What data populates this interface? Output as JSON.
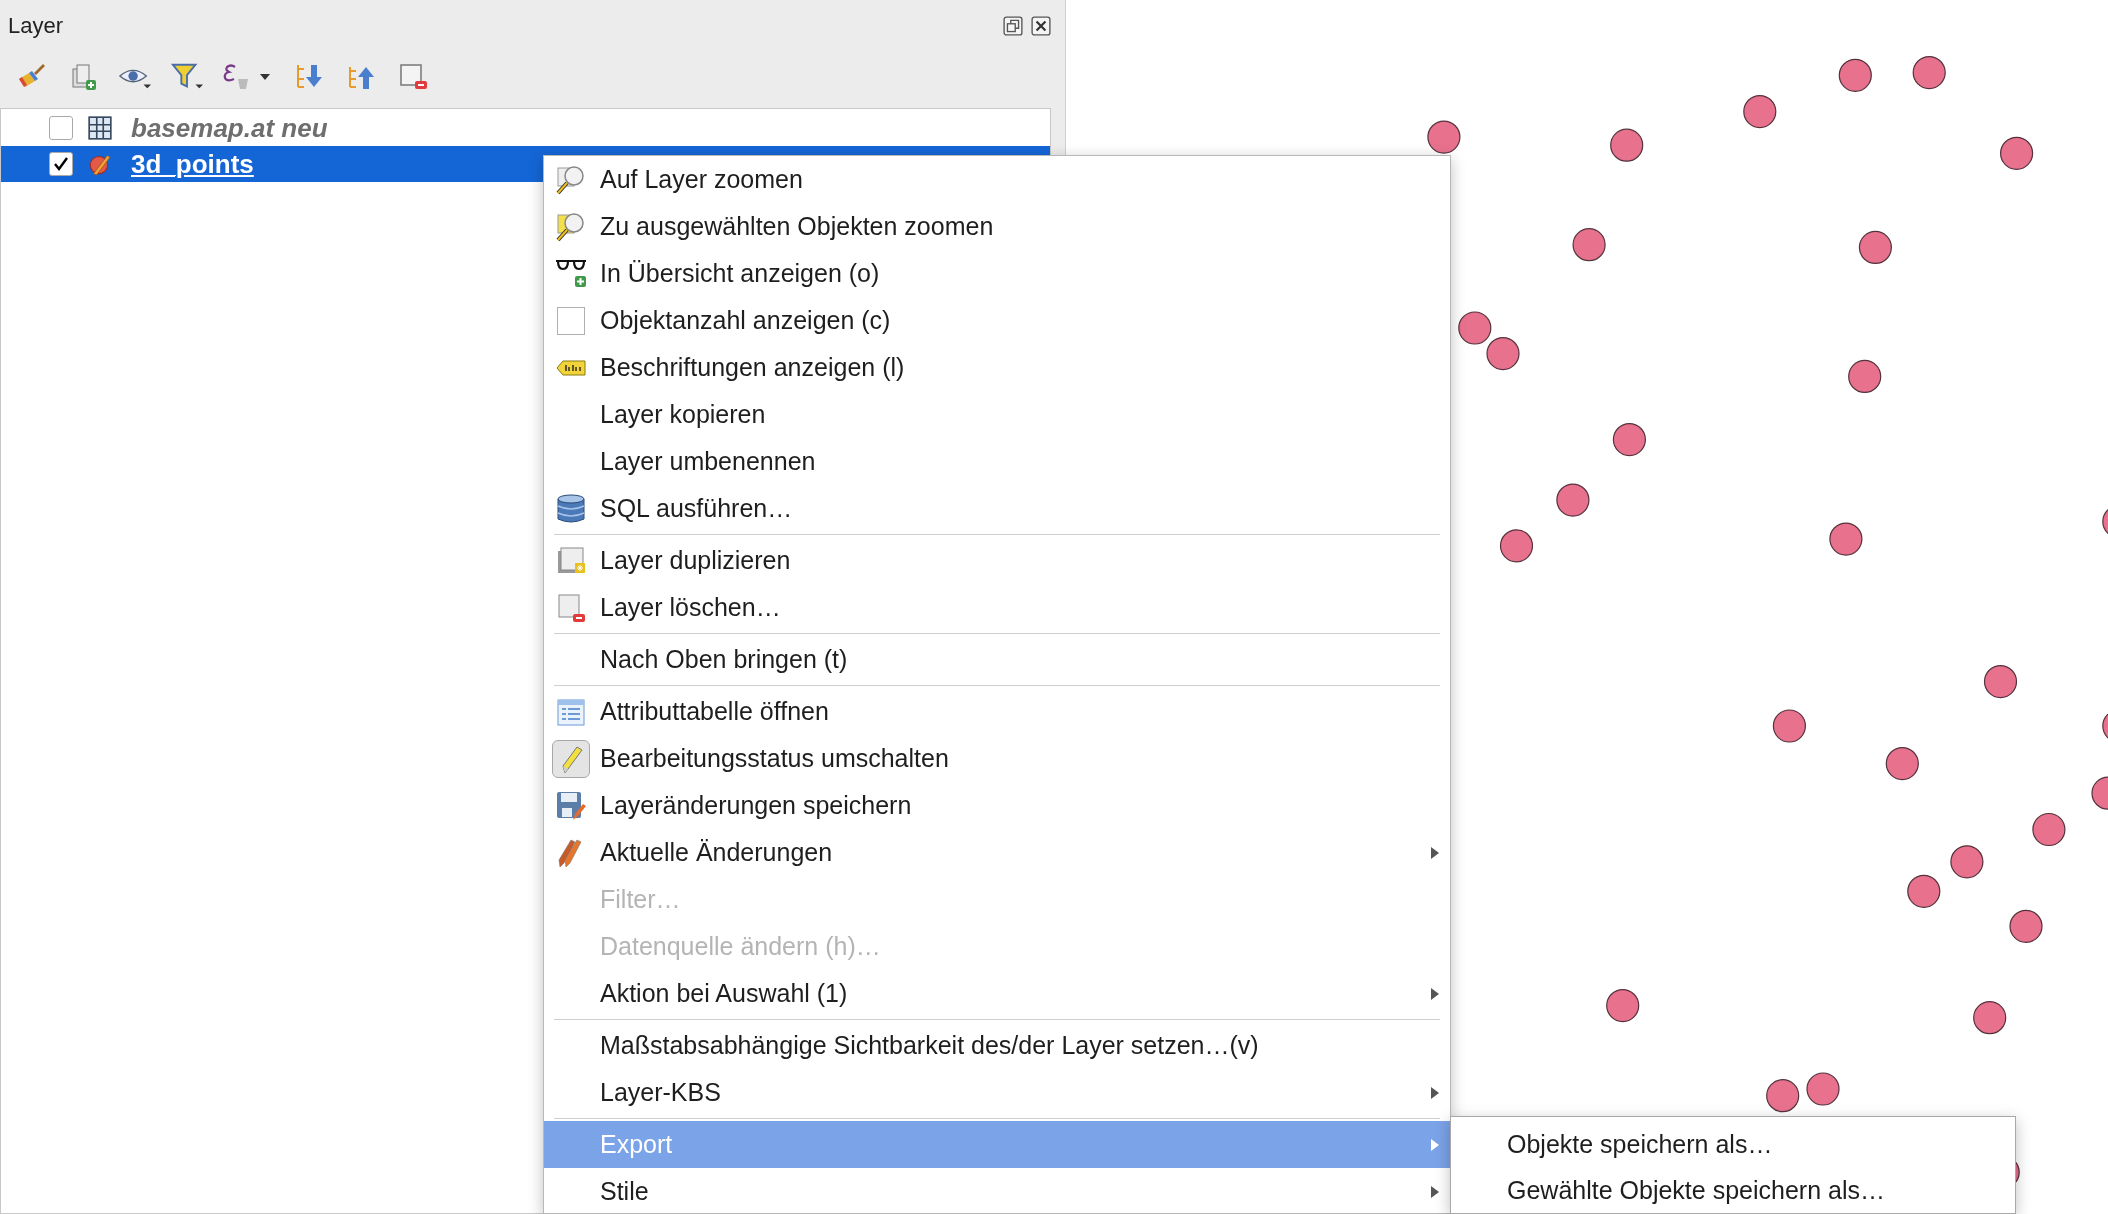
{
  "panel": {
    "title": "Layer"
  },
  "layers": [
    {
      "name": "basemap.at neu",
      "checked": false,
      "selected": false,
      "kind": "raster"
    },
    {
      "name": "3d_points",
      "checked": true,
      "selected": true,
      "kind": "vector"
    }
  ],
  "context_menu": {
    "items": [
      {
        "kind": "item",
        "label": "Auf Layer zoomen",
        "selected": false,
        "disabled": false,
        "submenu": false
      },
      {
        "kind": "item",
        "label": "Zu ausgewählten Objekten zoomen",
        "selected": false,
        "disabled": false,
        "submenu": false
      },
      {
        "kind": "item",
        "label": "In Übersicht anzeigen (o)",
        "selected": false,
        "disabled": false,
        "submenu": false
      },
      {
        "kind": "checkbox",
        "label": "Objektanzahl anzeigen (c)",
        "checked": false,
        "selected": false,
        "disabled": false,
        "submenu": false
      },
      {
        "kind": "item",
        "label": "Beschriftungen anzeigen (l)",
        "selected": false,
        "disabled": false,
        "submenu": false
      },
      {
        "kind": "item",
        "label": "Layer kopieren",
        "selected": false,
        "disabled": false,
        "submenu": false
      },
      {
        "kind": "item",
        "label": "Layer umbenennen",
        "selected": false,
        "disabled": false,
        "submenu": false
      },
      {
        "kind": "item",
        "label": "SQL ausführen…",
        "selected": false,
        "disabled": false,
        "submenu": false
      },
      {
        "kind": "separator"
      },
      {
        "kind": "item",
        "label": "Layer duplizieren",
        "selected": false,
        "disabled": false,
        "submenu": false
      },
      {
        "kind": "item",
        "label": "Layer löschen…",
        "selected": false,
        "disabled": false,
        "submenu": false
      },
      {
        "kind": "separator"
      },
      {
        "kind": "item",
        "label": "Nach Oben bringen (t)",
        "selected": false,
        "disabled": false,
        "submenu": false
      },
      {
        "kind": "separator"
      },
      {
        "kind": "item",
        "label": "Attributtabelle öffnen",
        "selected": false,
        "disabled": false,
        "submenu": false
      },
      {
        "kind": "toggle",
        "label": "Bearbeitungsstatus umschalten",
        "checked": true,
        "selected": false,
        "disabled": false,
        "submenu": false
      },
      {
        "kind": "item",
        "label": "Layeränderungen speichern",
        "selected": false,
        "disabled": false,
        "submenu": false
      },
      {
        "kind": "item",
        "label": "Aktuelle Änderungen",
        "selected": false,
        "disabled": false,
        "submenu": true
      },
      {
        "kind": "item",
        "label": "Filter…",
        "selected": false,
        "disabled": true,
        "submenu": false
      },
      {
        "kind": "item",
        "label": "Datenquelle ändern (h)…",
        "selected": false,
        "disabled": true,
        "submenu": false
      },
      {
        "kind": "item",
        "label": "Aktion bei Auswahl (1)",
        "selected": false,
        "disabled": false,
        "submenu": true
      },
      {
        "kind": "separator"
      },
      {
        "kind": "item",
        "label": "Maßstabsabhängige Sichtbarkeit des/der Layer setzen…(v)",
        "selected": false,
        "disabled": false,
        "submenu": false
      },
      {
        "kind": "item",
        "label": "Layer-KBS",
        "selected": false,
        "disabled": false,
        "submenu": true
      },
      {
        "kind": "separator"
      },
      {
        "kind": "item",
        "label": "Export",
        "selected": true,
        "disabled": false,
        "submenu": true
      },
      {
        "kind": "item",
        "label": "Stile",
        "selected": false,
        "disabled": false,
        "submenu": true
      }
    ]
  },
  "submenu": {
    "items": [
      {
        "label": "Objekte speichern als…",
        "selected": false
      },
      {
        "label": "Gewählte Objekte speichern als…",
        "selected": false
      }
    ]
  }
}
